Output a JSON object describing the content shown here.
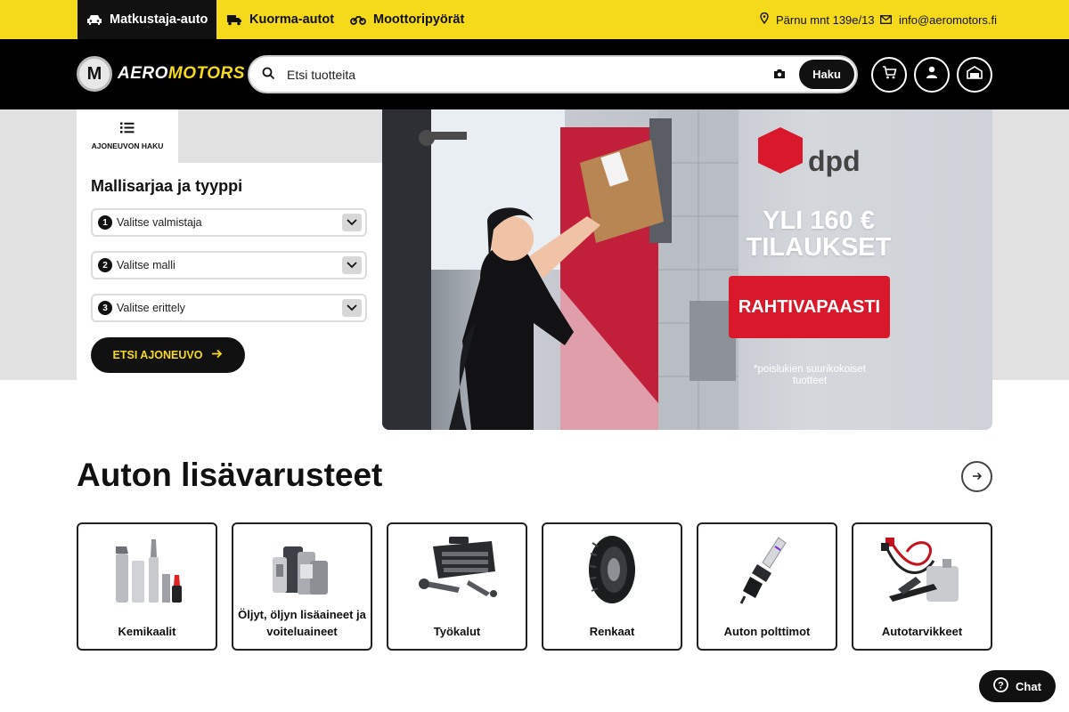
{
  "vehicle_tabs": [
    {
      "label": "Matkustaja-auto",
      "icon": "car-icon",
      "active": true
    },
    {
      "label": "Kuorma-autot",
      "icon": "truck-icon",
      "active": false
    },
    {
      "label": "Moottoripyörät",
      "icon": "motorcycle-icon",
      "active": false
    }
  ],
  "contact": {
    "address": "Pärnu mnt 139e/13",
    "email": "info@aeromotors.fi"
  },
  "header": {
    "logo_mark": "M",
    "logo_aero": "AERO",
    "logo_motors": "MOTORS",
    "search_placeholder": "Etsi tuotteita",
    "search_button": "Haku"
  },
  "vehicle_search": {
    "tab_label": "AJONEUVON HAKU",
    "title": "Mallisarjaa ja tyyppi",
    "selects": [
      {
        "num": "1",
        "label": "Valitse valmistaja"
      },
      {
        "num": "2",
        "label": "Valitse malli"
      },
      {
        "num": "3",
        "label": "Valitse erittely"
      }
    ],
    "submit": "ETSI AJONEUVO"
  },
  "banner": {
    "brand": "dpd",
    "headline_line1": "YLI 160 €",
    "headline_line2": "TILAUKSET",
    "badge": "RAHTIVAPAASTI",
    "note": "*poislukien suurikokoiset tuotteet"
  },
  "section": {
    "title": "Auton lisävarusteet"
  },
  "categories": [
    {
      "label": "Kemikaalit",
      "icon": "chemicals-icon"
    },
    {
      "label": "Öljyt, öljyn lisäaineet ja voiteluaineet",
      "icon": "oil-bottles-icon"
    },
    {
      "label": "Työkalut",
      "icon": "toolbox-icon"
    },
    {
      "label": "Renkaat",
      "icon": "tire-icon"
    },
    {
      "label": "Auton polttimot",
      "icon": "bulb-icon"
    },
    {
      "label": "Autotarvikkeet",
      "icon": "jumper-cables-icon"
    }
  ],
  "chat": {
    "label": "Chat"
  },
  "colors": {
    "brand_yellow": "#f5da1c",
    "black": "#111111",
    "promo_red": "#d9192b"
  }
}
